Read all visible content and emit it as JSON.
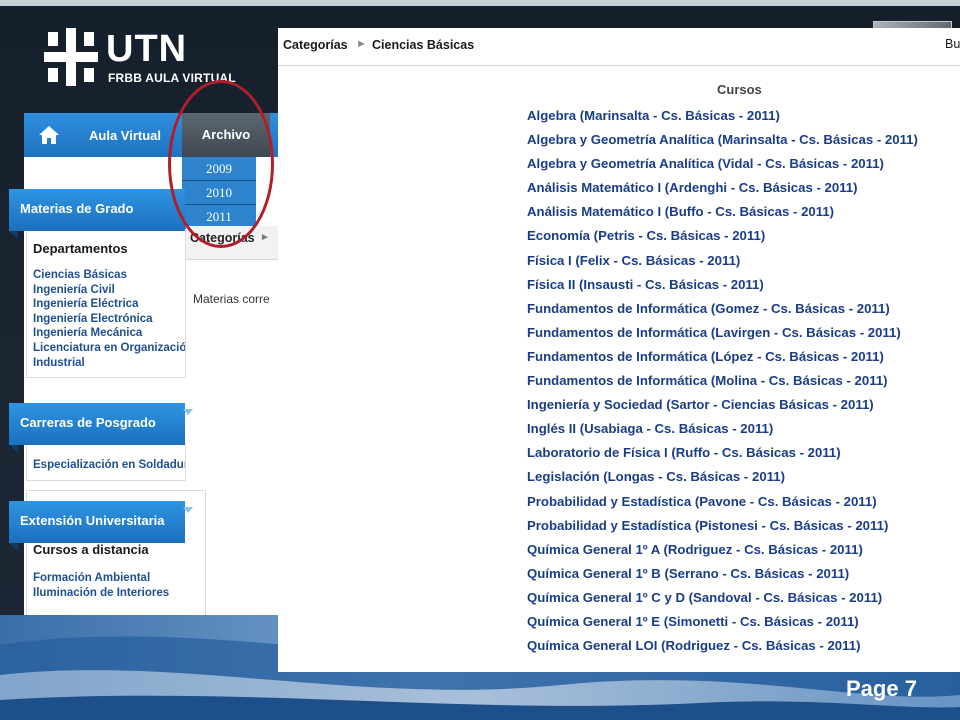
{
  "site": {
    "logo_name": "UTN",
    "logo_sub": "FRBB AULA VIRTUAL",
    "nav": {
      "home_icon": "home-icon",
      "aula_virtual": "Aula Virtual",
      "archivo": "Archivo"
    },
    "archive_years": [
      "2009",
      "2010",
      "2011"
    ],
    "sections": [
      {
        "tab": "Materias de Grado",
        "heading": "Departamentos",
        "links": [
          "Ciencias Básicas",
          "Ingeniería Civil",
          "Ingeniería Eléctrica",
          "Ingeniería Electrónica",
          "Ingeniería Mecánica",
          "Licenciatura en Organizació",
          "Industrial"
        ]
      },
      {
        "tab": "Carreras de Posgrado",
        "heading": "",
        "links": [
          "Especialización en Soldadur"
        ]
      },
      {
        "tab": "Extensión Universitaria",
        "heading": "Cursos a distancia",
        "links": [
          "Formación Ambiental",
          "Iluminación de Interiores"
        ]
      }
    ],
    "under_breadcrumb": "Categorías",
    "under_text": "Materias corre"
  },
  "course_window": {
    "breadcrumb": {
      "root": "Categorías",
      "separator": "►",
      "current": "Ciencias Básicas",
      "right_cut": "Bu"
    },
    "title": "Cursos",
    "courses": [
      "Algebra (Marinsalta - Cs. Básicas - 2011)",
      "Algebra y Geometría Analítica (Marinsalta - Cs. Básicas - 2011)",
      "Algebra y Geometría Analítica (Vidal - Cs. Básicas - 2011)",
      "Análisis Matemático I (Ardenghi - Cs. Básicas - 2011)",
      "Análisis Matemático I (Buffo - Cs. Básicas - 2011)",
      "Economía (Petris - Cs. Básicas - 2011)",
      "Física I (Felix - Cs. Básicas - 2011)",
      "Física II (Insausti - Cs. Básicas - 2011)",
      "Fundamentos de Informática (Gomez - Cs. Básicas - 2011)",
      "Fundamentos de Informática (Lavirgen - Cs. Básicas - 2011)",
      "Fundamentos de Informática (López - Cs. Básicas - 2011)",
      "Fundamentos de Informática (Molina - Cs. Básicas - 2011)",
      "Ingeniería y Sociedad (Sartor - Ciencias Básicas - 2011)",
      "Inglés II (Usabiaga - Cs. Básicas - 2011)",
      "Laboratorio de Física I (Ruffo - Cs. Básicas - 2011)",
      "Legislación (Longas - Cs. Básicas - 2011)",
      "Probabilidad y Estadística (Pavone - Cs. Básicas - 2011)",
      "Probabilidad y Estadística (Pistonesi - Cs. Básicas - 2011)",
      "Química General 1º A (Rodriguez - Cs. Básicas - 2011)",
      "Química General 1º B (Serrano - Cs. Básicas - 2011)",
      "Química General 1º C y D (Sandoval - Cs. Básicas - 2011)",
      "Química General 1º E (Simonetti - Cs. Básicas - 2011)",
      "Química General LOI (Rodriguez - Cs. Básicas - 2011)"
    ]
  },
  "slide": {
    "page_label": "Page 7"
  },
  "colors": {
    "nav_blue": "#1f73c0",
    "link_blue": "#1a3d88",
    "dark_bg": "#16202c",
    "annotation_red": "#b01e28"
  }
}
